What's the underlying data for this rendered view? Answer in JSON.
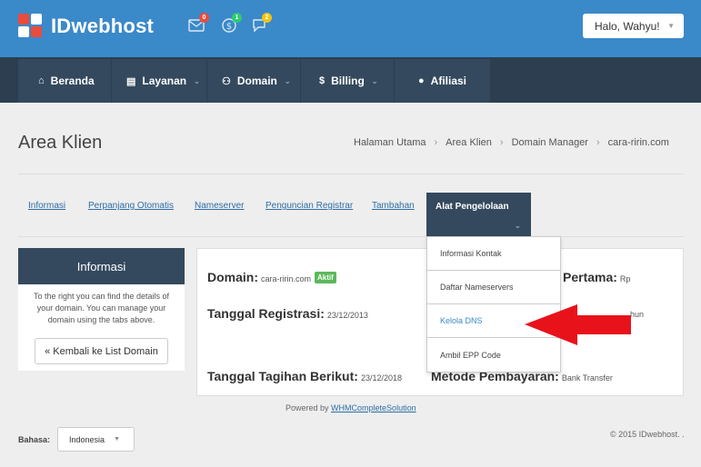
{
  "brand": {
    "name": "IDwebhost"
  },
  "header": {
    "notifications": [
      {
        "icon": "envelope-icon",
        "count": "0",
        "color": "#e84c3d"
      },
      {
        "icon": "dollar-icon",
        "count": "1",
        "color": "#2ecc71"
      },
      {
        "icon": "chat-icon",
        "count": "2",
        "color": "#f1c40f"
      }
    ],
    "user_greeting": "Halo, Wahyu!"
  },
  "nav": {
    "items": [
      {
        "label": "Beranda",
        "icon": "home-icon"
      },
      {
        "label": "Layanan",
        "icon": "list-icon"
      },
      {
        "label": "Domain",
        "icon": "binoculars-icon"
      },
      {
        "label": "Billing",
        "icon": "dollar-icon"
      },
      {
        "label": "Afiliasi",
        "icon": "user-icon"
      }
    ]
  },
  "page": {
    "title": "Area Klien",
    "breadcrumb": [
      "Halaman Utama",
      "Area Klien",
      "Domain Manager",
      "cara-ririn.com"
    ]
  },
  "tabs": {
    "items": [
      "Informasi",
      "Perpanjang Otomatis",
      "Nameserver",
      "Penguncian Registrar",
      "Tambahan"
    ],
    "active": "Alat Pengelolaan"
  },
  "dropdown": {
    "items": [
      "Informasi Kontak",
      "Daftar Nameservers",
      "Kelola DNS",
      "Ambil EPP Code"
    ],
    "selected": "Kelola DNS"
  },
  "sidebar": {
    "title": "Informasi",
    "text": "To the right you can find the details of your domain. You can manage your domain using the tabs above.",
    "back_button": "« Kembali ke List Domain"
  },
  "details": {
    "domain_label": "Domain:",
    "domain_value": "cara-ririn.com",
    "status": "Aktif",
    "reg_label": "Tanggal Registrasi:",
    "reg_value": "23/12/2013",
    "next_due_label": "Tanggal Tagihan Berikut:",
    "next_due_value": "23/12/2018",
    "first_payment_label": "Pertama:",
    "first_payment_value": "Rp",
    "partial_value": "hun",
    "payment_method_label": "Metode Pembayaran:",
    "payment_method_value": "Bank Transfer"
  },
  "footer": {
    "powered_prefix": "Powered by",
    "powered_link": "WHMCompleteSolution",
    "copyright": "© 2015 IDwebhost. .",
    "language_label": "Bahasa:",
    "language_value": "Indonesia"
  },
  "colors": {
    "header_blue": "#3a89c9",
    "nav_dark": "#34495e",
    "arrow_red": "#e8121b",
    "status_green": "#5cb85c"
  }
}
